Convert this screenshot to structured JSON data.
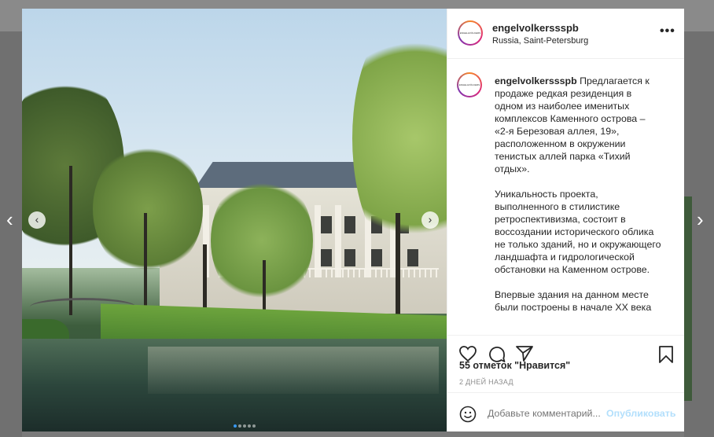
{
  "post": {
    "username": "engelvolkerssspb",
    "location": "Russia, Saint-Petersburg",
    "avatar_text": "ENGEL&VÖLKERS",
    "caption_user": "engelvolkerssspb",
    "caption_text": " Предлагается к продаже редкая резиденция в одном из наиболее именитых комплексов Каменного острова – «2-я Березовая аллея, 19», расположенном в окружении тенистых аллей парка «Тихий отдых».\n\nУникальность проекта, выполненного в стилистике ретроспективизма, состоит в воссоздании исторического облика не только зданий, но и окружающего ландшафта и гидрологической обстановки на Каменном острове.\n\nВпервые здания на данном месте были построены в начале XX века",
    "likes": "55 отметок \"Нравится\"",
    "time": "2 ДНЕЙ НАЗАД",
    "comment_placeholder": "Добавьте комментарий...",
    "publish_label": "Опубликовать",
    "more_label": "•••"
  },
  "carousel": {
    "total": 5,
    "current": 1
  },
  "icons": [
    "heart-icon",
    "comment-icon",
    "share-icon",
    "bookmark-icon",
    "emoji-icon",
    "chevron-left-icon",
    "chevron-right-icon"
  ],
  "colors": {
    "accent": "#3897f0",
    "publish_disabled": "#b2dffc",
    "text": "#262626",
    "muted": "#8e8e8e"
  }
}
